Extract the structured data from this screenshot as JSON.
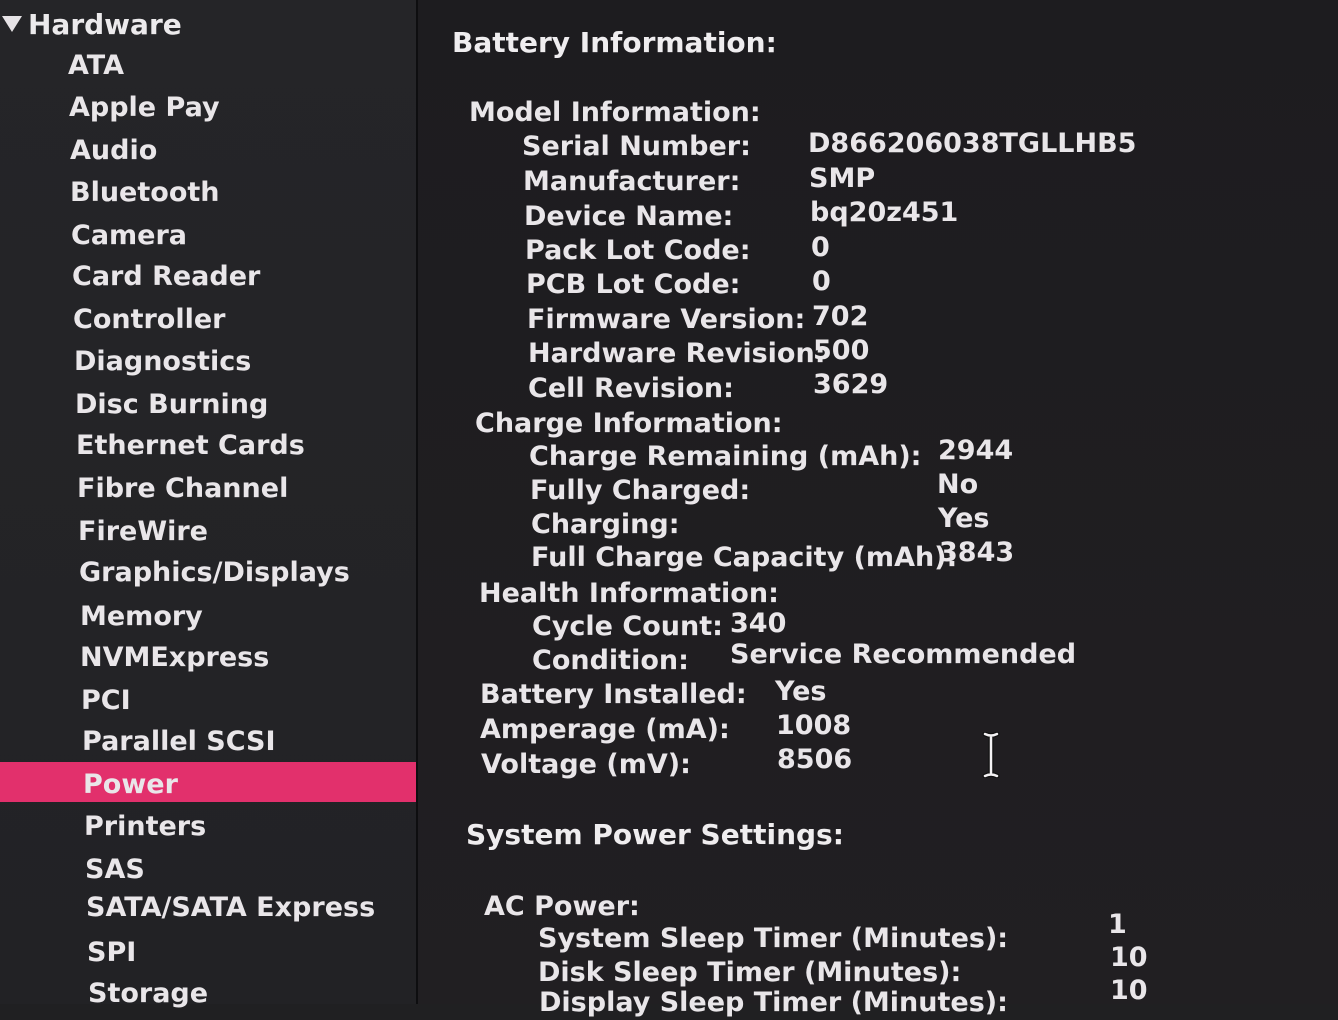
{
  "sidebar": {
    "header": "Hardware",
    "items": [
      {
        "label": "ATA"
      },
      {
        "label": "Apple Pay"
      },
      {
        "label": "Audio"
      },
      {
        "label": "Bluetooth"
      },
      {
        "label": "Camera"
      },
      {
        "label": "Card Reader"
      },
      {
        "label": "Controller"
      },
      {
        "label": "Diagnostics"
      },
      {
        "label": "Disc Burning"
      },
      {
        "label": "Ethernet Cards"
      },
      {
        "label": "Fibre Channel"
      },
      {
        "label": "FireWire"
      },
      {
        "label": "Graphics/Displays"
      },
      {
        "label": "Memory"
      },
      {
        "label": "NVMExpress"
      },
      {
        "label": "PCI"
      },
      {
        "label": "Parallel SCSI"
      },
      {
        "label": "Power",
        "selected": true
      },
      {
        "label": "Printers"
      },
      {
        "label": "SAS"
      },
      {
        "label": "SATA/SATA Express"
      },
      {
        "label": "SPI"
      },
      {
        "label": "Storage"
      }
    ],
    "selected_color": "#e2306c"
  },
  "battery": {
    "title": "Battery Information:",
    "model": {
      "heading": "Model Information:",
      "serial_label": "Serial Number:",
      "serial_value": "D866206038TGLLHB5",
      "manufacturer_label": "Manufacturer:",
      "manufacturer_value": "SMP",
      "device_label": "Device Name:",
      "device_value": "bq20z451",
      "pack_lot_label": "Pack Lot Code:",
      "pack_lot_value": "0",
      "pcb_lot_label": "PCB Lot Code:",
      "pcb_lot_value": "0",
      "firmware_label": "Firmware Version:",
      "firmware_value": "702",
      "hardware_label": "Hardware Revision:",
      "hardware_value": "500",
      "cell_label": "Cell Revision:",
      "cell_value": "3629"
    },
    "charge": {
      "heading": "Charge Information:",
      "remaining_label": "Charge Remaining (mAh):",
      "remaining_value": "2944",
      "fully_label": "Fully Charged:",
      "fully_value": "No",
      "charging_label": "Charging:",
      "charging_value": "Yes",
      "capacity_label": "Full Charge Capacity (mAh):",
      "capacity_value": "3843"
    },
    "health": {
      "heading": "Health Information:",
      "cycle_label": "Cycle Count:",
      "cycle_value": "340",
      "condition_label": "Condition:",
      "condition_value": "Service Recommended"
    },
    "installed_label": "Battery Installed:",
    "installed_value": "Yes",
    "amperage_label": "Amperage (mA):",
    "amperage_value": "1008",
    "voltage_label": "Voltage (mV):",
    "voltage_value": "8506"
  },
  "power_settings": {
    "title": "System Power Settings:",
    "ac_heading": "AC Power:",
    "system_sleep_label": "System Sleep Timer (Minutes):",
    "system_sleep_value": "1",
    "disk_sleep_label": "Disk Sleep Timer (Minutes):",
    "disk_sleep_value": "10",
    "display_sleep_label": "Display Sleep Timer (Minutes):",
    "display_sleep_value": "10"
  }
}
